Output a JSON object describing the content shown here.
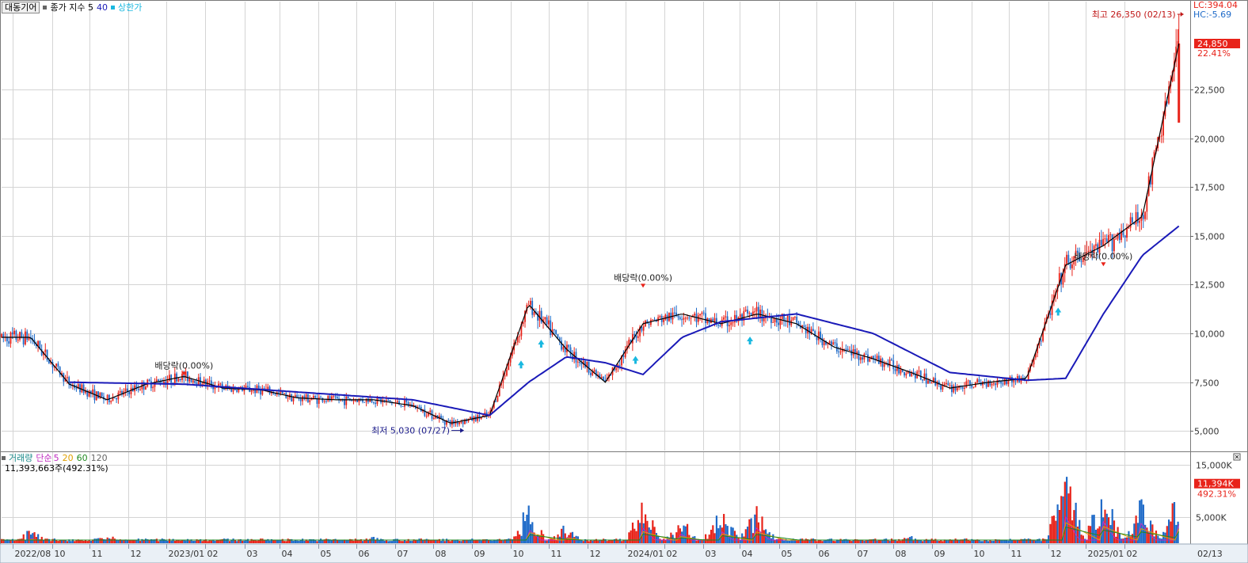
{
  "header": {
    "stock_button": "대동기어",
    "indicator_label": "종가 지수 5",
    "ma_label": "40",
    "limit_label": "상한가",
    "lc": "LC:394.04",
    "hc": "HC:-5.69"
  },
  "volume_legend": {
    "title": "거래량",
    "simple": "단순",
    "p5": "5",
    "p20": "20",
    "p60": "60",
    "p120": "120",
    "volume_value": "11,393,663주(492.31%)"
  },
  "badges": {
    "price": "24,850",
    "price_pct": "22.41%",
    "volume": "11,394K",
    "volume_pct": "492.31%"
  },
  "annotations": {
    "high": "최고 26,350 (02/13)",
    "low": "최저 5,030 (07/27)",
    "dividend": "배당락(0.00%)"
  },
  "colors": {
    "up": "#e8231a",
    "down": "#1e6ac8",
    "ma5": "#000000",
    "ma40": "#1a1ab8",
    "limit_up": "#19b8e0",
    "grid": "#d4d4d4",
    "axis_bg": "#eaf0f6"
  },
  "chart_data": [
    {
      "type": "line",
      "title": "대동기어",
      "subtitle": "종가 지수 5 40",
      "ylim": [
        4000,
        27000
      ],
      "y_ticks": [
        "5,000",
        "7,500",
        "10,000",
        "12,500",
        "15,000",
        "17,500",
        "20,000",
        "22,500"
      ],
      "x_ticks": [
        "2022/08",
        "10",
        "11",
        "12",
        "2023/01",
        "02",
        "03",
        "04",
        "05",
        "06",
        "07",
        "08",
        "09",
        "10",
        "11",
        "12",
        "2024/01",
        "02",
        "03",
        "04",
        "05",
        "06",
        "07",
        "08",
        "09",
        "10",
        "11",
        "12",
        "2025/01",
        "02"
      ],
      "date_label": "02/13",
      "series": [
        {
          "name": "종가",
          "x": [
            "2022-08",
            "2022-09",
            "2022-10",
            "2022-11",
            "2022-12",
            "2023-01",
            "2023-02",
            "2023-03",
            "2023-04",
            "2023-05",
            "2023-06",
            "2023-07",
            "2023-08",
            "2023-09",
            "2023-10",
            "2023-11",
            "2023-12",
            "2024-01",
            "2024-02",
            "2024-03",
            "2024-04",
            "2024-05",
            "2024-06",
            "2024-07",
            "2024-08",
            "2024-09",
            "2024-10",
            "2024-11",
            "2024-12",
            "2025-01",
            "2025-02-13"
          ],
          "values": [
            9800,
            7400,
            6600,
            7400,
            7800,
            7200,
            7100,
            6700,
            6600,
            6600,
            6300,
            5400,
            5800,
            11500,
            9200,
            7500,
            10500,
            11000,
            10500,
            11000,
            10500,
            9300,
            8700,
            8000,
            7200,
            7500,
            7700,
            13500,
            14500,
            16000,
            24850
          ]
        },
        {
          "name": "40",
          "x": [
            "2022-09",
            "2022-12",
            "2023-03",
            "2023-06",
            "2023-08",
            "2023-09",
            "2023-10",
            "2023-11",
            "2023-12",
            "2024-01",
            "2024-02",
            "2024-04",
            "2024-06",
            "2024-08",
            "2024-10",
            "2024-11",
            "2024-12",
            "2025-01",
            "2025-02-13"
          ],
          "values": [
            7500,
            7400,
            7000,
            6600,
            5800,
            7500,
            8800,
            8500,
            7900,
            9800,
            10600,
            11000,
            10000,
            8000,
            7600,
            7700,
            11000,
            14000,
            15500
          ]
        }
      ],
      "markers": [
        {
          "label": "최고 26,350 (02/13)",
          "date": "2025-02-13",
          "value": 26350
        },
        {
          "label": "최저 5,030 (07/27)",
          "date": "2023-07-27",
          "value": 5030
        },
        {
          "label": "배당락(0.00%)",
          "date": "2022-12",
          "value": 7800
        },
        {
          "label": "배당락(0.00%)",
          "date": "2023-12",
          "value": 12300
        },
        {
          "label": "배당락(0.00%)",
          "date": "2024-12",
          "value": 13400
        }
      ],
      "limit_up_dates": [
        "2023-09",
        "2023-09",
        "2023-12",
        "2024-03",
        "2024-11"
      ]
    },
    {
      "type": "bar",
      "title": "거래량",
      "ylim": [
        0,
        16500
      ],
      "y_ticks": [
        "5,000K",
        "15,000K"
      ],
      "unit": "K",
      "spikes": [
        {
          "date": "2022-08",
          "value": 3000
        },
        {
          "date": "2022-10",
          "value": 2000
        },
        {
          "date": "2023-05",
          "value": 1500
        },
        {
          "date": "2023-09",
          "value": 8500
        },
        {
          "date": "2023-10",
          "value": 4000
        },
        {
          "date": "2023-12",
          "value": 9000
        },
        {
          "date": "2024-01",
          "value": 5000
        },
        {
          "date": "2024-02",
          "value": 7500
        },
        {
          "date": "2024-03",
          "value": 8500
        },
        {
          "date": "2024-07",
          "value": 1500
        },
        {
          "date": "2024-11",
          "value": 16000
        },
        {
          "date": "2024-12",
          "value": 13000
        },
        {
          "date": "2025-01",
          "value": 11000
        },
        {
          "date": "2025-02-13",
          "value": 11394
        }
      ]
    }
  ]
}
